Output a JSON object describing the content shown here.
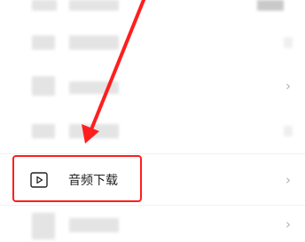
{
  "download_row": {
    "label": "音频下载",
    "icon": "play-square-icon",
    "chevron": "›"
  },
  "other_rows": {
    "chevron": "›"
  },
  "annotation": {
    "highlight_color": "#ff1e1e"
  }
}
